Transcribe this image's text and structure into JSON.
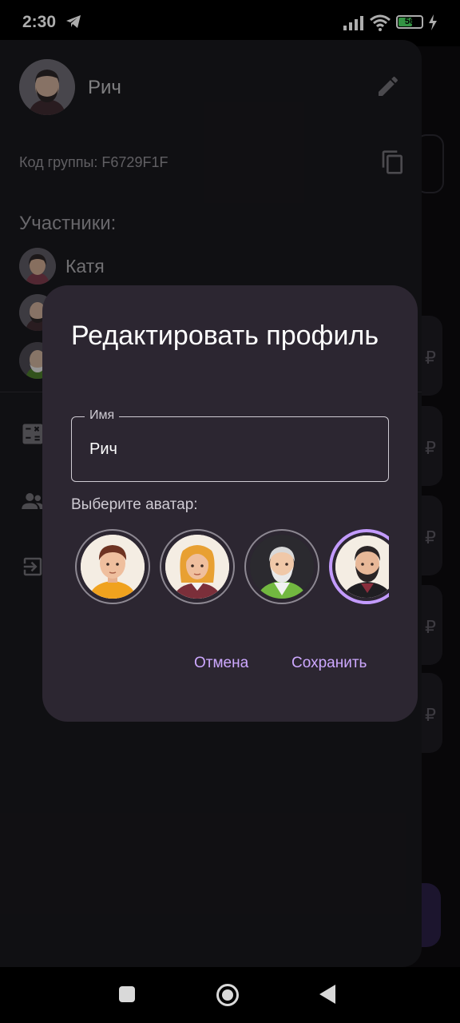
{
  "status_bar": {
    "time": "2:30",
    "battery": "56"
  },
  "drawer": {
    "user_name": "Рич",
    "group_code": "Код группы: F6729F1F",
    "members_title": "Участники:",
    "members": [
      {
        "name": "Катя"
      }
    ]
  },
  "dialog": {
    "title": "Редактировать профиль",
    "name_field": {
      "label": "Имя",
      "value": "Рич"
    },
    "avatar_label": "Выберите аватар:",
    "avatars": [
      "young-man-avatar",
      "blonde-woman-avatar",
      "old-man-avatar",
      "bearded-man-avatar"
    ],
    "selected_avatar": "bearded-man-avatar",
    "cancel_label": "Отмена",
    "save_label": "Сохранить"
  },
  "colors": {
    "accent": "#cda8ff",
    "dialog_bg": "#2c2631",
    "drawer_bg": "#19181c",
    "selected_ring": "#c39bff"
  },
  "icons": [
    "telegram-icon",
    "signal-icon",
    "wifi-icon",
    "battery-icon",
    "charging-icon",
    "edit-icon",
    "copy-icon",
    "calculator-icon",
    "group-icon",
    "logout-icon",
    "recents-icon",
    "home-icon",
    "back-icon"
  ]
}
